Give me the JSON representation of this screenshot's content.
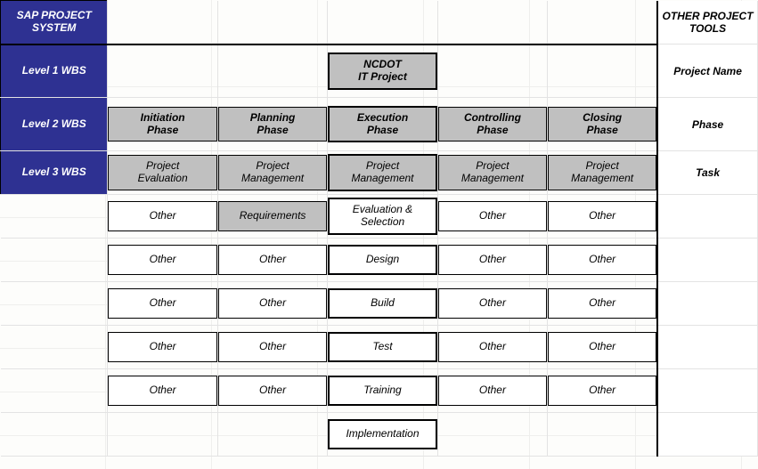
{
  "header": {
    "left": "SAP PROJECT SYSTEM",
    "right": "OTHER PROJECT TOOLS"
  },
  "levels": {
    "l1": {
      "label": "Level 1 WBS",
      "right": "Project Name"
    },
    "l2": {
      "label": "Level 2 WBS",
      "right": "Phase"
    },
    "l3": {
      "label": "Level 3 WBS",
      "right": "Task"
    }
  },
  "l1_project": "NCDOT\nIT Project",
  "phases": {
    "c1": "Initiation\nPhase",
    "c2": "Planning\nPhase",
    "c3": "Execution\nPhase",
    "c4": "Controlling\nPhase",
    "c5": "Closing\nPhase"
  },
  "tasks": {
    "r1": {
      "c1": "Project\nEvaluation",
      "c2": "Project\nManagement",
      "c3": "Project\nManagement",
      "c4": "Project\nManagement",
      "c5": "Project\nManagement",
      "shade": true
    },
    "r2": {
      "c1": "Other",
      "c2": "Requirements",
      "c3": "Evaluation & Selection",
      "c4": "Other",
      "c5": "Other",
      "c2_shade": true
    },
    "r3": {
      "c1": "Other",
      "c2": "Other",
      "c3": "Design",
      "c4": "Other",
      "c5": "Other"
    },
    "r4": {
      "c1": "Other",
      "c2": "Other",
      "c3": "Build",
      "c4": "Other",
      "c5": "Other"
    },
    "r5": {
      "c1": "Other",
      "c2": "Other",
      "c3": "Test",
      "c4": "Other",
      "c5": "Other"
    },
    "r6": {
      "c1": "Other",
      "c2": "Other",
      "c3": "Training",
      "c4": "Other",
      "c5": "Other"
    },
    "r7": {
      "c3": "Implementation"
    }
  }
}
